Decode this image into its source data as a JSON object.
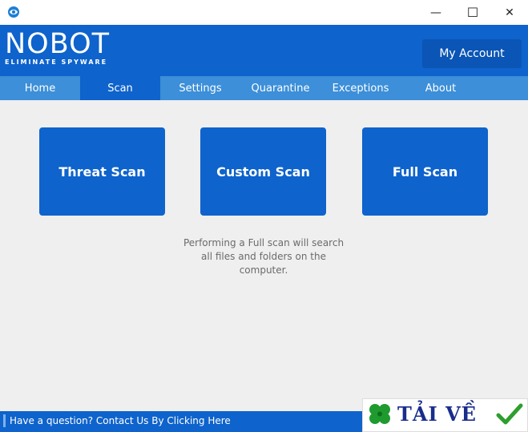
{
  "window": {
    "minimize_glyph": "—",
    "maximize_glyph": "☐",
    "close_glyph": "✕"
  },
  "logo": {
    "name": "NOBOT",
    "tagline": "ELIMINATE SPYWARE"
  },
  "header": {
    "account_label": "My Account"
  },
  "nav": {
    "items": [
      {
        "label": "Home",
        "active": false
      },
      {
        "label": "Scan",
        "active": true
      },
      {
        "label": "Settings",
        "active": false
      },
      {
        "label": "Quarantine",
        "active": false
      },
      {
        "label": "Exceptions",
        "active": false
      },
      {
        "label": "About",
        "active": false
      }
    ]
  },
  "scan": {
    "cards": [
      {
        "label": "Threat Scan"
      },
      {
        "label": "Custom Scan"
      },
      {
        "label": "Full Scan"
      }
    ],
    "description": "Performing a Full scan will search all files and folders on the computer."
  },
  "status": {
    "text": "Have a question? Contact Us By Clicking Here"
  },
  "watermark": {
    "text": "TẢI VỀ"
  },
  "colors": {
    "brand_blue": "#0e63cc",
    "nav_blue": "#3c8fd8",
    "content_bg": "#efefef"
  }
}
